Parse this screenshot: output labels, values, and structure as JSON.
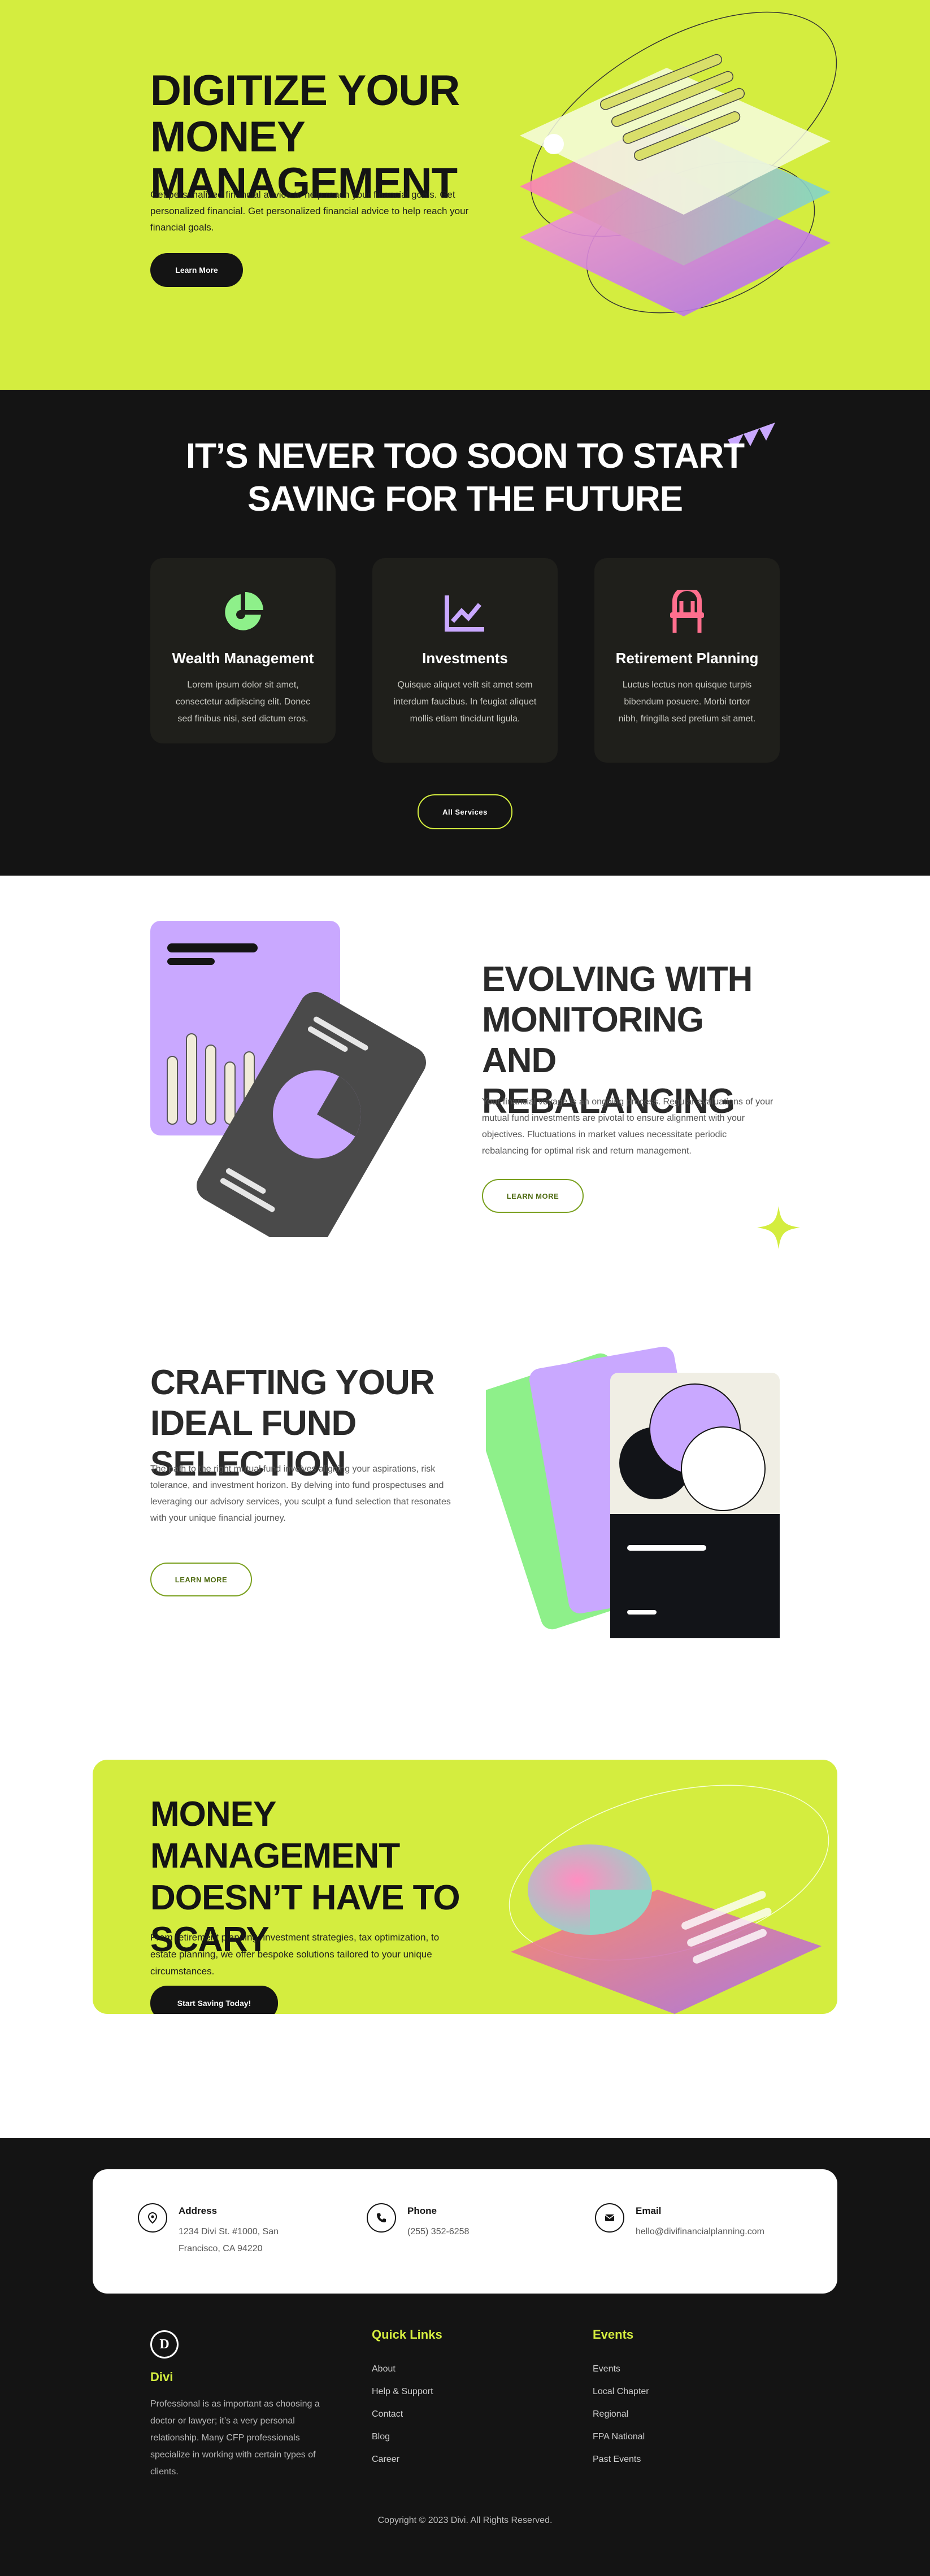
{
  "hero": {
    "title": "DIGITIZE YOUR MONEY MANAGEMENT",
    "text": "Get personalized financial advice to help reach your financial goals. Get personalized financial. Get personalized financial advice to help reach your financial goals.",
    "button": "Learn More"
  },
  "services": {
    "title": "IT’S NEVER TOO SOON TO START SAVING FOR THE FUTURE",
    "cards": [
      {
        "title": "Wealth Management",
        "text": "Lorem ipsum dolor sit amet, consectetur adipiscing elit. Donec sed finibus nisi, sed dictum eros.",
        "icon": "pie-chart-icon",
        "color": "#8ef08a"
      },
      {
        "title": "Investments",
        "text": "Quisque aliquet velit sit amet sem interdum faucibus. In feugiat aliquet mollis etiam tincidunt ligula.",
        "icon": "line-chart-icon",
        "color": "#c9a8ff"
      },
      {
        "title": "Retirement Planning",
        "text": "Luctus lectus non quisque turpis bibendum posuere. Morbi tortor nibh, fringilla sed pretium sit amet.",
        "icon": "chair-icon",
        "color": "#ff6f8e"
      }
    ],
    "button": "All Services"
  },
  "feature1": {
    "title": "EVOLVING WITH MONITORING AND REBALANCING",
    "text": "Your financial voyage is an ongoing process. Regular evaluations of your mutual fund investments are pivotal to ensure alignment with your objectives. Fluctuations in market values necessitate periodic rebalancing for optimal risk and return management.",
    "button": "LEARN MORE"
  },
  "feature2": {
    "title": "CRAFTING YOUR IDEAL FUND SELECTION",
    "text": "The path to the right mutual fund involves aligning your aspirations, risk tolerance, and investment horizon. By delving into fund prospectuses and leveraging our advisory services, you sculpt a fund selection that resonates with your unique financial journey.",
    "button": "LEARN MORE"
  },
  "cta": {
    "title": "MONEY MANAGEMENT DOESN’T HAVE TO SCARY",
    "text": "From retirement planning, investment strategies, tax optimization, to estate planning, we offer bespoke solutions tailored to your unique circumstances.",
    "button": "Start Saving Today!"
  },
  "contact": {
    "address": {
      "label": "Address",
      "value": "1234 Divi St. #1000, San Francisco, CA 94220",
      "icon": "map-pin-icon"
    },
    "phone": {
      "label": "Phone",
      "value": "(255) 352-6258",
      "icon": "phone-icon"
    },
    "email": {
      "label": "Email",
      "value": "hello@divifinancialplanning.com",
      "icon": "mail-icon"
    }
  },
  "footer": {
    "brand": "Divi",
    "brand_logo_letter": "D",
    "description": "Professional is as important as choosing a doctor or lawyer; it’s a very personal relationship. Many CFP professionals specialize in working with certain types of clients.",
    "quick_links_title": "Quick Links",
    "quick_links": [
      "About",
      "Help & Support",
      "Contact",
      "Blog",
      "Career"
    ],
    "events_title": "Events",
    "events": [
      "Events",
      "Local Chapter",
      "Regional",
      "FPA National",
      "Past Events"
    ],
    "copyright": "Copyright © 2023 Divi. All Rights Reserved."
  },
  "colors": {
    "lime": "#d4ed3f",
    "dark": "#141414",
    "purple": "#c9a8ff",
    "green": "#8ef08a",
    "pink": "#ff6f8e"
  }
}
